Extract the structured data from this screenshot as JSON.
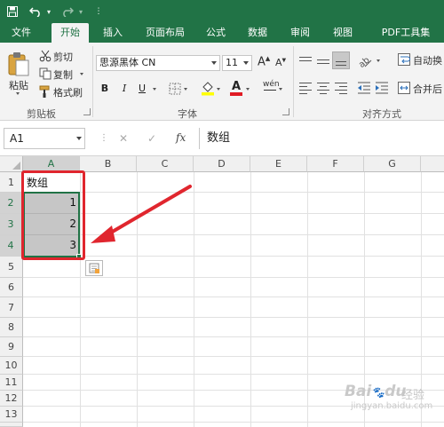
{
  "titlebar": {
    "icons": [
      "save-icon",
      "undo-icon",
      "redo-icon",
      "customize-qat-icon"
    ],
    "bg": "#217346"
  },
  "tabs": [
    {
      "label": "文件"
    },
    {
      "label": "开始",
      "active": true
    },
    {
      "label": "插入"
    },
    {
      "label": "页面布局"
    },
    {
      "label": "公式"
    },
    {
      "label": "数据"
    },
    {
      "label": "审阅"
    },
    {
      "label": "视图"
    },
    {
      "label": "PDF工具集"
    }
  ],
  "clipboard": {
    "paste": "粘贴",
    "cut": "剪切",
    "copy": "复制",
    "format_painter": "格式刷",
    "group": "剪贴板"
  },
  "font": {
    "name": "思源黑体 CN",
    "size": "11",
    "grow": "A",
    "shrink": "A",
    "bold": "B",
    "italic": "I",
    "underline": "U",
    "font_color_glyph": "A",
    "phonetic": "wén",
    "group": "字体"
  },
  "alignment": {
    "wrap_text": "自动换",
    "merge": "合并后",
    "group": "对齐方式"
  },
  "formula_bar": {
    "name_box": "A1",
    "cancel": "✕",
    "enter": "✓",
    "fx": "fx",
    "content": "数组"
  },
  "sheet": {
    "columns": [
      "A",
      "B",
      "C",
      "D",
      "E",
      "F",
      "G"
    ],
    "rows": [
      "1",
      "2",
      "3",
      "4",
      "5",
      "6",
      "7",
      "8",
      "9",
      "10",
      "11",
      "12",
      "13"
    ],
    "cells": {
      "A1": "数组",
      "A2": "1",
      "A3": "2",
      "A4": "3"
    }
  },
  "annotation": {
    "box_color": "#e0262e",
    "arrow_color": "#e0262e"
  },
  "watermark": {
    "brand": "Bai",
    "brand2": "du",
    "text": "经验",
    "url": "jingyan.baidu.com"
  }
}
